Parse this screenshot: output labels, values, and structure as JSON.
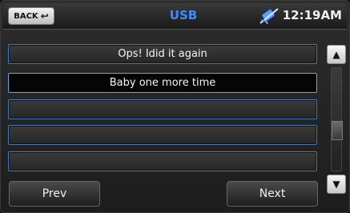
{
  "header": {
    "back_label": "BACK",
    "title": "USB",
    "time": "12:19AM",
    "nav_icon": "satellite-icon"
  },
  "playlist": {
    "items": [
      {
        "label": "Ops! Idid it again"
      },
      {
        "label": "Baby one more time"
      },
      {
        "label": ""
      },
      {
        "label": ""
      },
      {
        "label": ""
      }
    ],
    "selected_index": 1
  },
  "scrollbar": {
    "up_icon": "up-arrow-icon",
    "down_icon": "down-arrow-icon"
  },
  "footer": {
    "prev_label": "Prev",
    "next_label": "Next"
  }
}
